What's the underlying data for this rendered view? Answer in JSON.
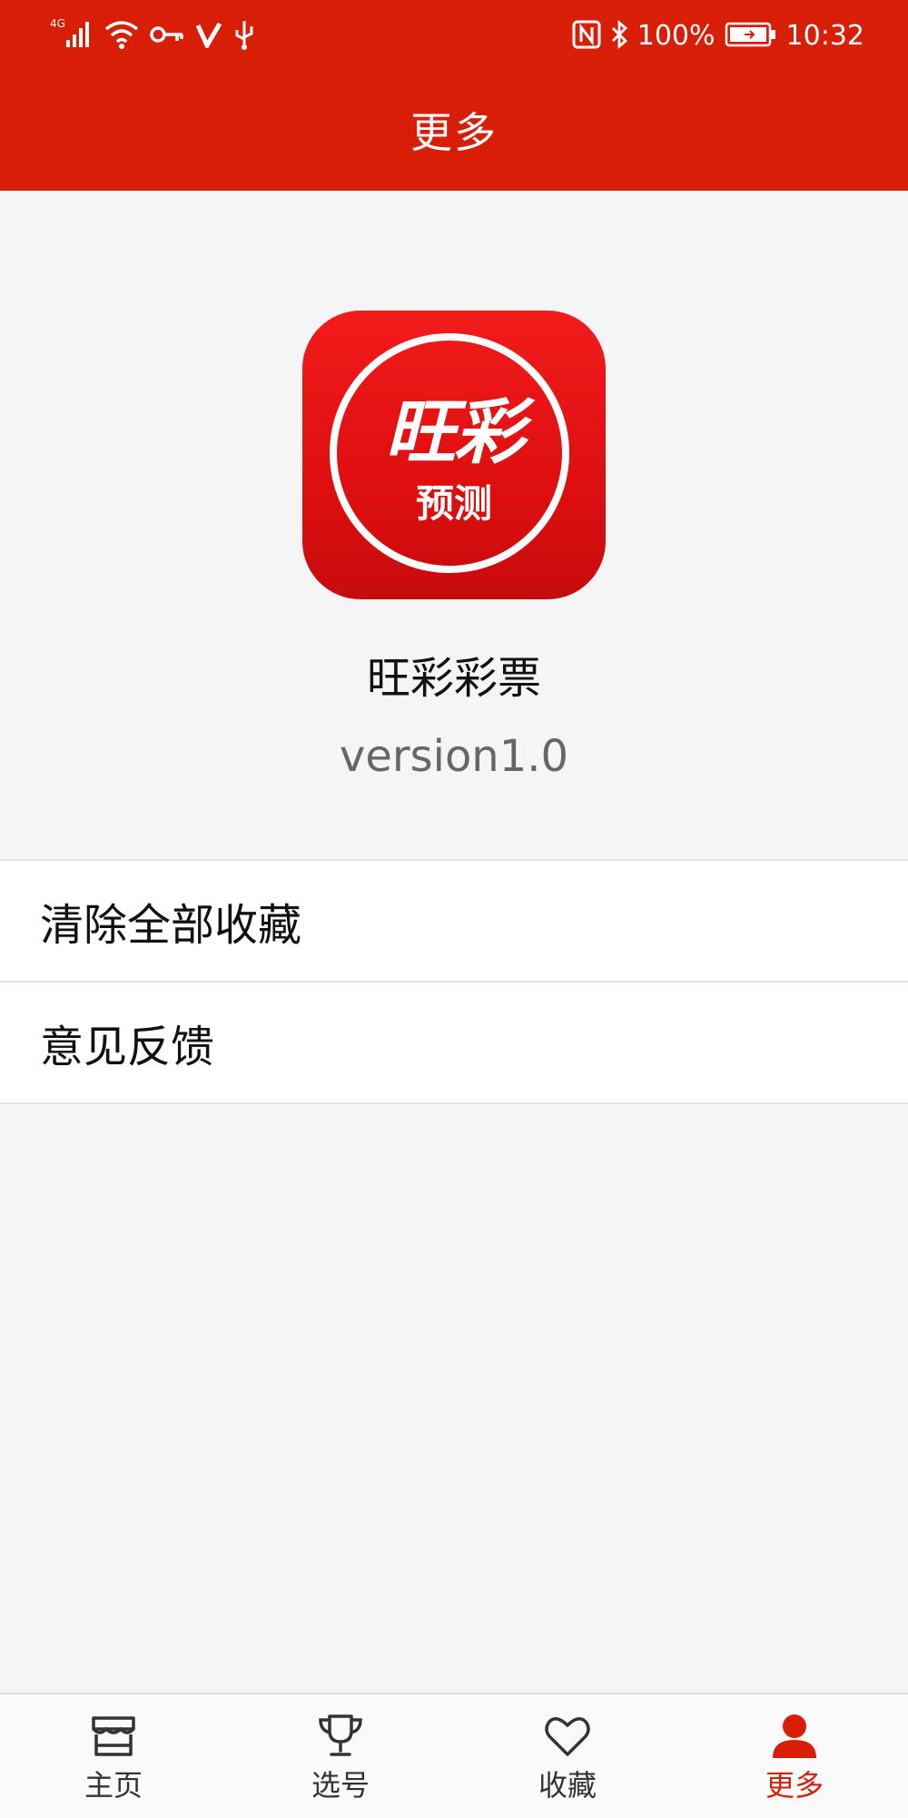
{
  "status_bar": {
    "network": "4G",
    "battery": "100%",
    "time": "10:32",
    "icons_left": [
      "signal-icon",
      "wifi-icon",
      "key-icon",
      "v-icon",
      "usb-icon"
    ],
    "icons_right": [
      "nfc-icon",
      "bluetooth-icon",
      "battery-icon"
    ]
  },
  "header": {
    "title": "更多"
  },
  "app": {
    "icon_text_top": "旺彩",
    "icon_text_bottom": "预测",
    "name": "旺彩彩票",
    "version": "version1.0"
  },
  "menu": {
    "items": [
      {
        "label": "清除全部收藏"
      },
      {
        "label": "意见反馈"
      }
    ]
  },
  "bottom_nav": {
    "items": [
      {
        "label": "主页",
        "icon": "shop-icon"
      },
      {
        "label": "选号",
        "icon": "trophy-icon"
      },
      {
        "label": "收藏",
        "icon": "heart-icon"
      },
      {
        "label": "更多",
        "icon": "person-icon"
      }
    ],
    "active_index": 3
  },
  "colors": {
    "brand_red": "#d81e06",
    "background": "#f5f5f5",
    "inactive_icon": "#333333"
  }
}
